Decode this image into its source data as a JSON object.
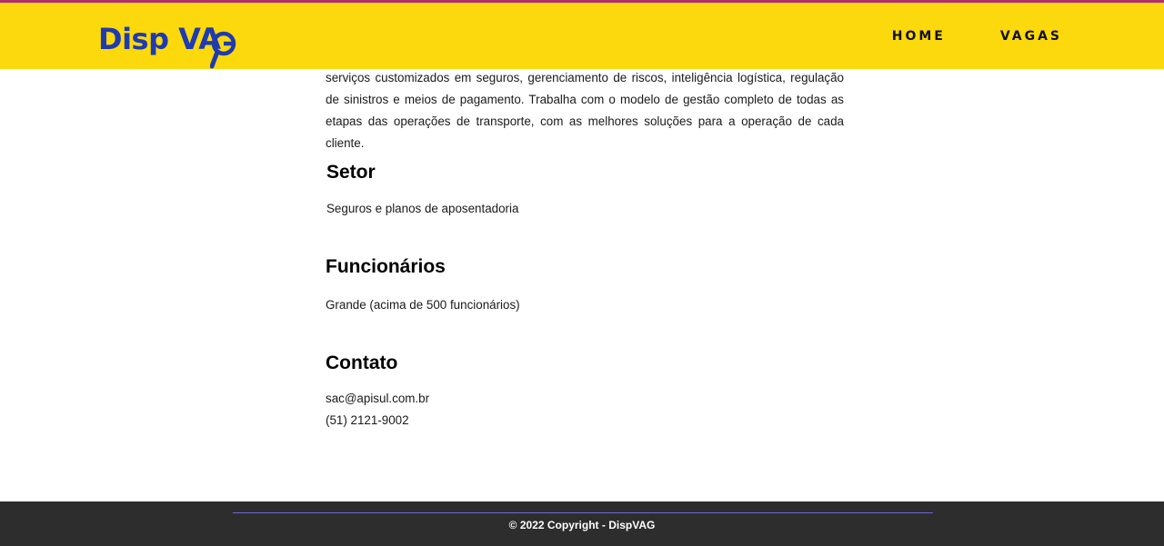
{
  "header": {
    "logo_text": "Disp VA",
    "logo_full": "Disp VAG",
    "nav": [
      {
        "label": "HOME"
      },
      {
        "label": "VAGAS"
      }
    ]
  },
  "content": {
    "intro": "serviços customizados em seguros, gerenciamento de riscos, inteligência logística, regulação de sinistros e meios de pagamento. Trabalha com o modelo de gestão completo de todas as etapas das operações de transporte, com as melhores soluções para a operação de cada cliente.",
    "setor": {
      "title": "Setor",
      "text": "Seguros e planos de aposentadoria"
    },
    "funcionarios": {
      "title": "Funcionários",
      "text": "Grande (acima de 500 funcionários)"
    },
    "contato": {
      "title": "Contato",
      "email": "sac@apisul.com.br",
      "phone": "(51) 2121-9002"
    }
  },
  "footer": {
    "copyright": "© 2022 Copyright - DispVAG"
  },
  "colors": {
    "header_bg": "#fcd90d",
    "header_border": "#b0306a",
    "logo": "#1f3bb0",
    "footer_bg": "#2d2d2d",
    "footer_line": "#6d6ad8"
  }
}
